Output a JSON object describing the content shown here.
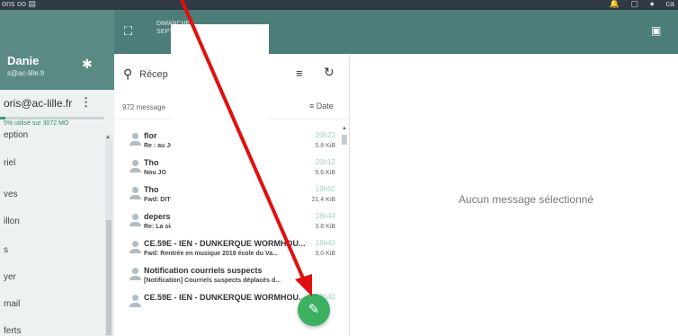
{
  "topbar": {
    "left_text": "ons  oo  ▤",
    "icons": [
      "bell-icon",
      "square-icon",
      "user-icon"
    ],
    "right_text": "ca"
  },
  "sidebar": {
    "user_name": "Danie",
    "user_email": "s@ac-lille.fr",
    "account": "oris@ac-lille.fr",
    "quota_text": "5% utilisé sur 3072 MO",
    "quota_fraction": 0.05,
    "folders": [
      "eption",
      "riel",
      "ves",
      "illon",
      "s",
      "yer",
      "mail",
      "ferts"
    ]
  },
  "column_bar": {
    "date_line1": "DIMANCHE",
    "date_line2": "SEPT"
  },
  "list": {
    "search_placeholder": "Récep",
    "count_text": "972 message",
    "sort_label": "Date",
    "messages": [
      {
        "from": "flor",
        "subject": "Re :                                     au JO",
        "time": "20h22",
        "size": "5.8 KiB"
      },
      {
        "from": "Tho",
        "subject": "Nou                                      JO",
        "time": "20h12",
        "size": "5.6 KiB"
      },
      {
        "from": "Tho",
        "subject": "Fwd:                                    DITOR A...",
        "time": "19h52",
        "size": "21.4 KiB"
      },
      {
        "from": "depersin maryse",
        "subject": "Re: La sieste à l'école maternelle",
        "time": "16h44",
        "size": "3.8 KiB"
      },
      {
        "from": "CE.59E - IEN - DUNKERQUE WORMHOU...",
        "subject": "Fwd: Rentrée en musique 2019 école du Va...",
        "time": "16h43",
        "size": "3.0 KiB"
      },
      {
        "from": "Notification courriels suspects",
        "subject": "[Notification] Courriels suspects déplacés d...",
        "time": "",
        "size": ""
      },
      {
        "from": "CE.59E - IEN - DUNKERQUE WORMHOU...",
        "subject": "",
        "time": "13h42",
        "size": ""
      }
    ]
  },
  "detail": {
    "empty_text": "Aucun message sélectionné"
  },
  "colors": {
    "header_green": "#4d7d78",
    "fab_green": "#3ab060",
    "annotation_red": "#e01010"
  }
}
